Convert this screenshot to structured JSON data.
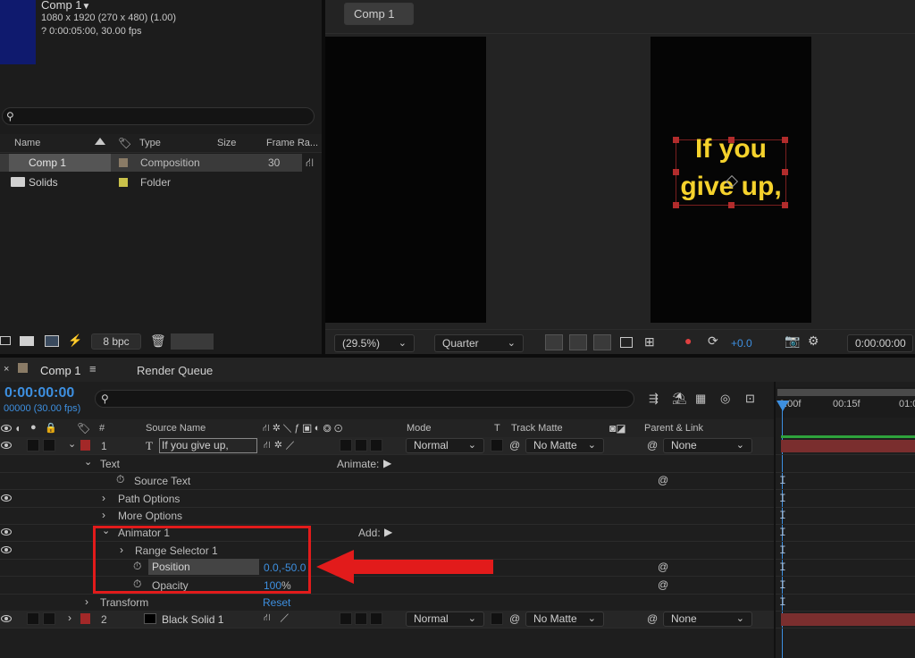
{
  "project": {
    "comp_name": "Comp 1",
    "comp_dims": "1080 x 1920  (270 x 480) (1.00)",
    "comp_dur": "? 0:00:05:00, 30.00 fps",
    "search_placeholder": "",
    "columns": {
      "name": "Name",
      "type": "Type",
      "size": "Size",
      "frame_rate": "Frame Ra..."
    },
    "items": [
      {
        "name": "Comp 1",
        "type": "Composition",
        "fps": "30",
        "label_color": "#8a7b66"
      },
      {
        "name": "Solids",
        "type": "Folder",
        "fps": "",
        "label_color": "#c9c14a"
      }
    ],
    "bpc": "8 bpc"
  },
  "viewer": {
    "tab": "Comp 1",
    "text_line1": "If you",
    "text_line2": "give up,",
    "magnification": "(29.5%)",
    "resolution": "Quarter",
    "exposure": "+0.0",
    "timecode": "0:00:00:00"
  },
  "timeline": {
    "tab": "Comp 1",
    "render_queue": "Render Queue",
    "timecode": "0:00:00:00",
    "frame_info": "00000 (30.00 fps)",
    "ruler": {
      "t0": "0:00f",
      "t1": "00:15f",
      "t2": "01:0"
    },
    "headers": {
      "num": "#",
      "source": "Source Name",
      "mode": "Mode",
      "t": "T",
      "track_matte": "Track Matte",
      "parent": "Parent & Link"
    },
    "layer1": {
      "num": "1",
      "name": "If you give up,",
      "mode": "Normal",
      "matte": "No Matte",
      "parent": "None"
    },
    "text_group": "Text",
    "animate_label": "Animate:",
    "source_text": "Source Text",
    "path_options": "Path Options",
    "more_options": "More Options",
    "animator": "Animator 1",
    "add_label": "Add:",
    "range_selector": "Range Selector 1",
    "position_label": "Position",
    "position_value": "0.0,-50.0",
    "opacity_label": "Opacity",
    "opacity_value": "100",
    "opacity_unit": "%",
    "transform": "Transform",
    "reset": "Reset",
    "layer2": {
      "num": "2",
      "name": "Black Solid 1",
      "mode": "Normal",
      "matte": "No Matte",
      "parent": "None"
    }
  },
  "colors": {
    "accent_blue": "#3d8fe0",
    "highlight_red": "#e21b1b",
    "text_yellow": "#f5d22c",
    "layer_label_red": "#a32828"
  }
}
